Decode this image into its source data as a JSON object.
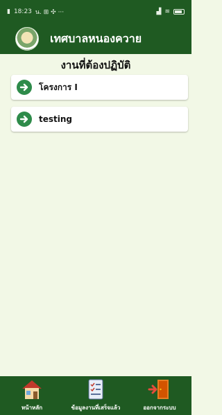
{
  "status": {
    "time": "18:23",
    "notifications": "น. ⊞ ✣ ···"
  },
  "app": {
    "title": "เทศบาลหนองควาย"
  },
  "page": {
    "title": "งานที่ต้องปฏิบัติ"
  },
  "tasks": [
    {
      "label": "โครงการ I"
    },
    {
      "label": "testing"
    }
  ],
  "nav": {
    "home_label": "หน้าหลัก",
    "done_label": "ข้อมูลงานที่เสร็จแล้ว",
    "logout_label": "ออกจากระบบ"
  },
  "colors": {
    "primary": "#1f5a22",
    "background": "#f2f8e6",
    "accent": "#2e8b4a"
  }
}
